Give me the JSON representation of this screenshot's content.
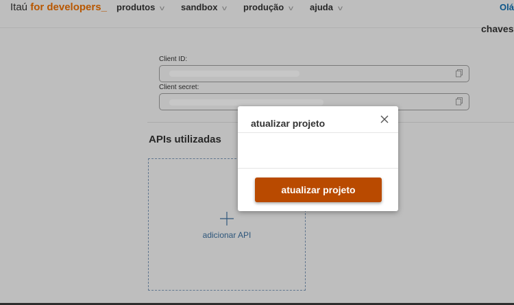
{
  "nav": {
    "brand_prefix": "Itaú",
    "brand_suffix": "for developers_",
    "items": [
      {
        "label": "produtos"
      },
      {
        "label": "sandbox"
      },
      {
        "label": "produção"
      },
      {
        "label": "ajuda"
      }
    ],
    "greeting": "Olá,"
  },
  "panel": {
    "heading": "chaves"
  },
  "credentials": {
    "client_id_label": "Client ID:",
    "client_secret_label": "Client secret:"
  },
  "apis": {
    "title": "APIs utilizadas",
    "add_label": "adicionar API"
  },
  "modal": {
    "title": "atualizar projeto",
    "button_label": "atualizar projeto"
  },
  "colors": {
    "brand_orange": "#ec7000",
    "button": "#b94a00",
    "link_blue": "#3b6f9e"
  },
  "icons": [
    "chevron-down-icon",
    "copy-icon",
    "plus-icon",
    "close-icon"
  ]
}
